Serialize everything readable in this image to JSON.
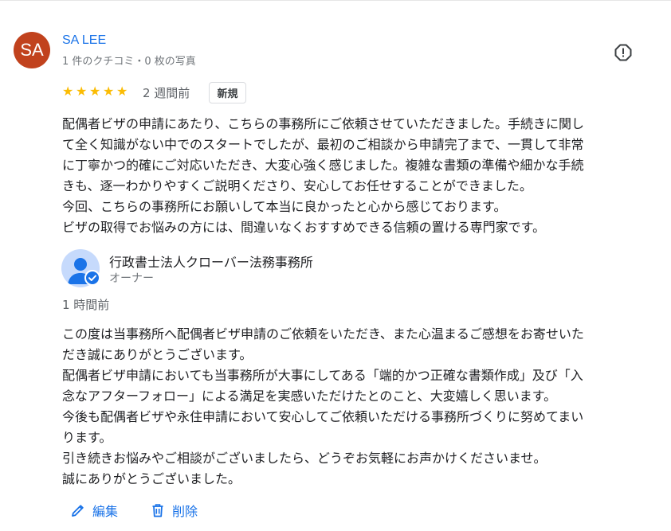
{
  "reviewer": {
    "initials": "SA",
    "name": "SA LEE",
    "meta": "1 件のクチコミ・0 枚の写真"
  },
  "review": {
    "rating": 5,
    "stars": [
      "★",
      "★",
      "★",
      "★",
      "★"
    ],
    "date": "2 週間前",
    "badge": "新規",
    "lines": [
      "配偶者ビザの申請にあたり、こちらの事務所にご依頼させていただきました。手続きに関し",
      "て全く知識がない中でのスタートでしたが、最初のご相談から申請完了まで、一貫して非常",
      "に丁寧かつ的確にご対応いただき、大変心強く感じました。複雑な書類の準備や細かな手続",
      "きも、逐一わかりやすくご説明くださり、安心してお任せすることができました。",
      "今回、こちらの事務所にお願いして本当に良かったと心から感じております。",
      "ビザの取得でお悩みの方には、間違いなくおすすめできる信頼の置ける専門家です。"
    ]
  },
  "owner_reply": {
    "name": "行政書士法人クローバー法務事務所",
    "role": "オーナー",
    "date": "1 時間前",
    "lines": [
      "この度は当事務所へ配偶者ビザ申請のご依頼をいただき、また心温まるご感想をお寄せいた",
      "だき誠にありがとうございます。",
      "配偶者ビザ申請においても当事務所が大事にしてある「端的かつ正確な書類作成」及び「入",
      "念なアフターフォロー」による満足を実感いただけたとのこと、大変嬉しく思います。",
      "今後も配偶者ビザや永住申請において安心してご依頼いただける事務所づくりに努めてまい",
      "ります。",
      "引き続きお悩みやご相談がございましたら、どうぞお気軽にお声かけくださいませ。",
      "誠にありがとうございました。"
    ]
  },
  "actions": {
    "edit_label": "編集",
    "delete_label": "削除"
  },
  "colors": {
    "accent": "#1a73e8",
    "avatar_bg": "#c1421d",
    "star": "#fbbc04"
  },
  "icons": {
    "report": "report-icon",
    "edit": "pencil-icon",
    "delete": "trash-icon",
    "verified": "verified-check-icon"
  }
}
